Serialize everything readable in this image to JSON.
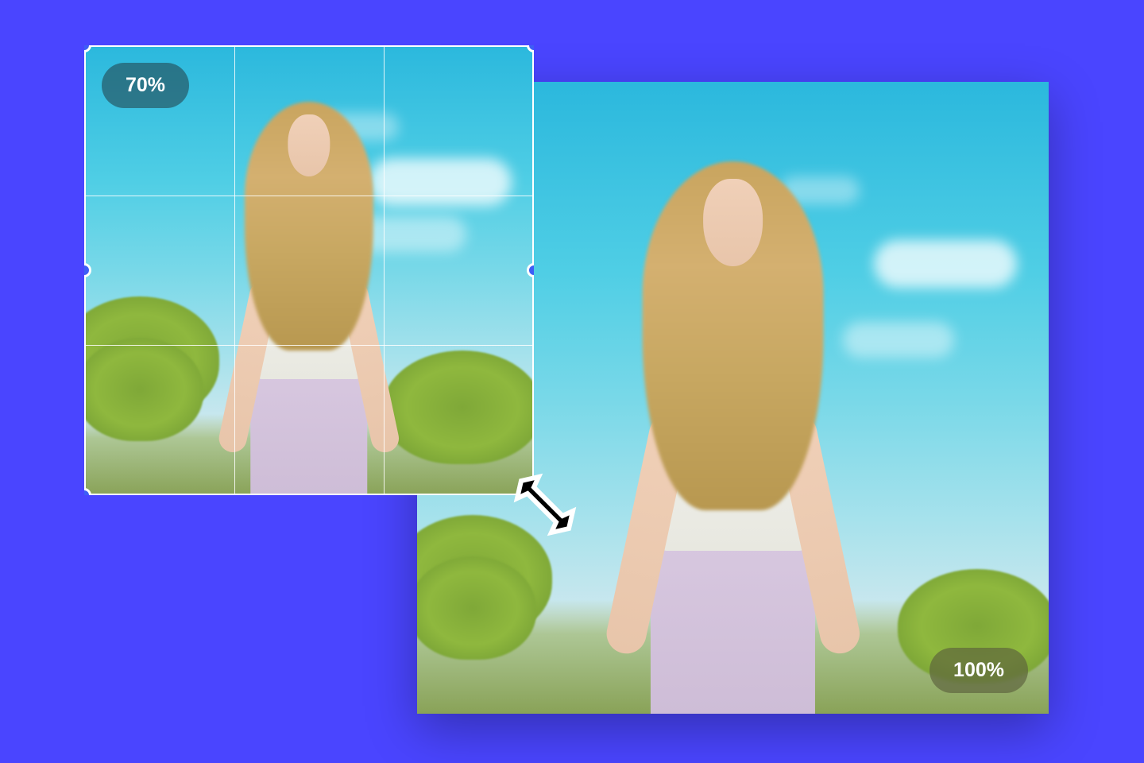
{
  "editor": {
    "smallPreview": {
      "zoomLabel": "70%"
    },
    "largePreview": {
      "zoomLabel": "100%"
    }
  },
  "icons": {
    "resize": "resize-diagonal"
  },
  "colors": {
    "background": "#4A45FF",
    "handle": "#3d5ef5"
  }
}
